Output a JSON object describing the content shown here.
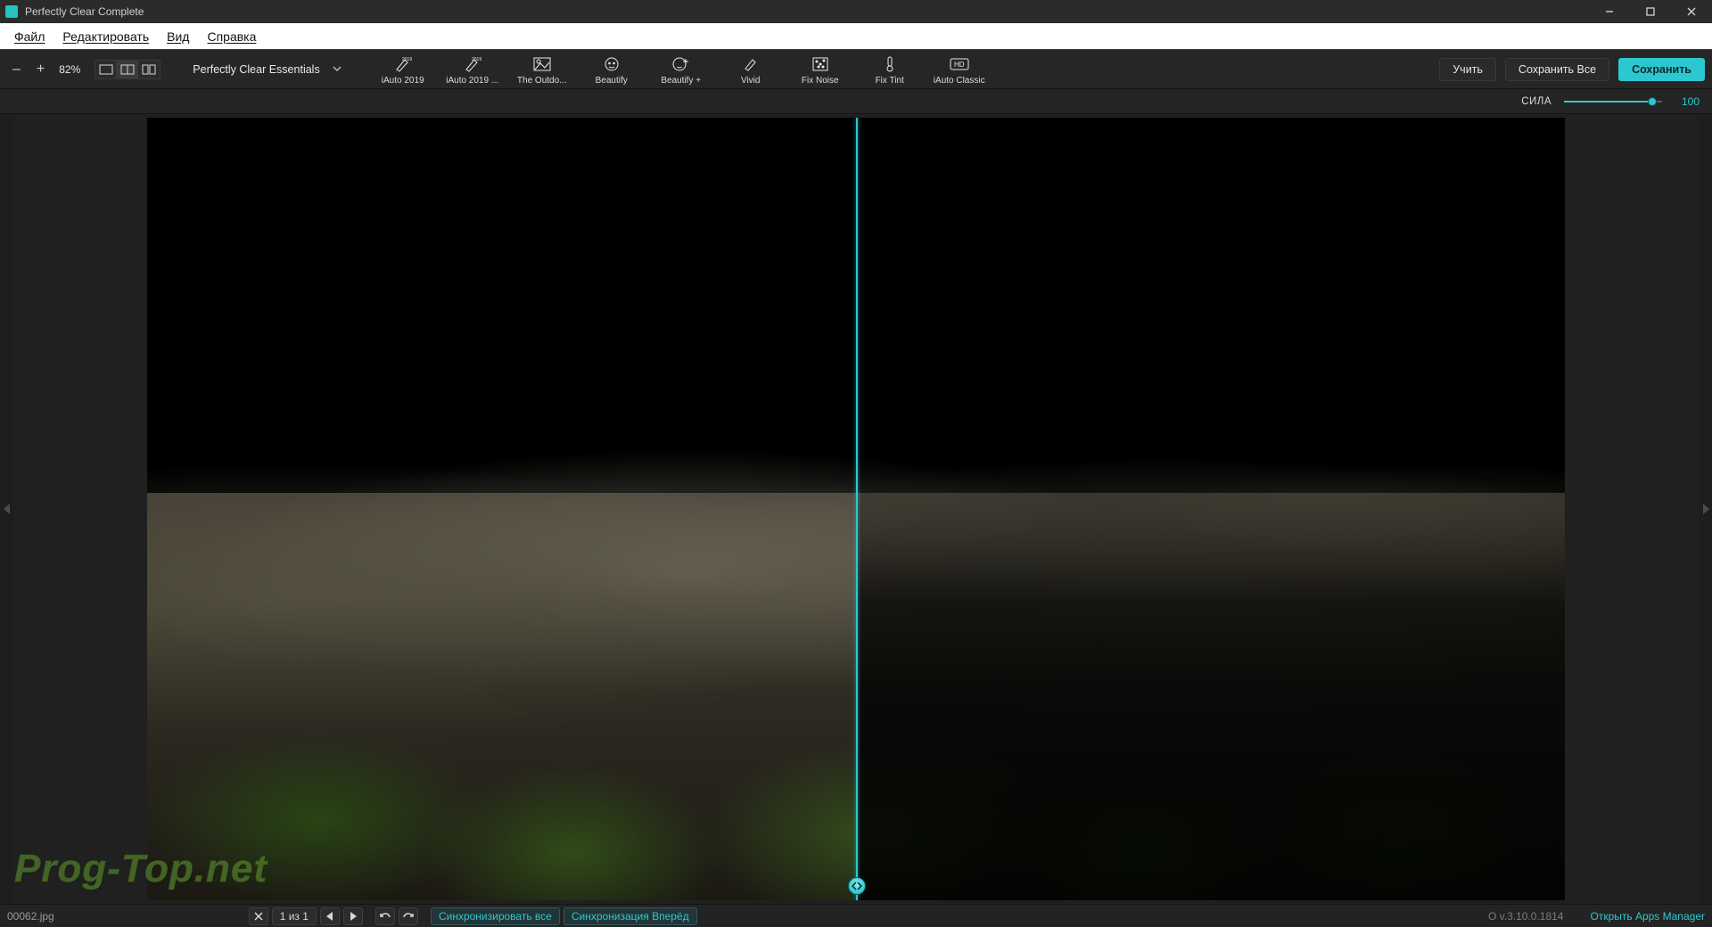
{
  "window": {
    "title": "Perfectly Clear Complete"
  },
  "menu": {
    "file": "Файл",
    "edit": "Редактировать",
    "view": "Вид",
    "help": "Справка"
  },
  "toolbar": {
    "zoom_minus": "–",
    "zoom_plus": "+",
    "zoom_value": "82%",
    "preset_selector": "Perfectly Clear Essentials",
    "presets": [
      {
        "label": "iAuto 2019"
      },
      {
        "label": "iAuto 2019 ..."
      },
      {
        "label": "The Outdo..."
      },
      {
        "label": "Beautify"
      },
      {
        "label": "Beautify +"
      },
      {
        "label": "Vivid"
      },
      {
        "label": "Fix Noise"
      },
      {
        "label": "Fix Tint"
      },
      {
        "label": "iAuto Classic"
      }
    ],
    "learn": "Учить",
    "save_all": "Сохранить Все",
    "save": "Сохранить"
  },
  "strength": {
    "label": "СИЛА",
    "value": "100",
    "percent": 90
  },
  "status": {
    "filename": "00062.jpg",
    "page": "1 из 1",
    "sync_all": "Синхронизировать все",
    "sync_forward": "Синхронизация Вперёд",
    "version": "O v.3.10.0.1814",
    "open_manager": "Открыть Apps Manager"
  },
  "watermark": "Prog-Top.net"
}
